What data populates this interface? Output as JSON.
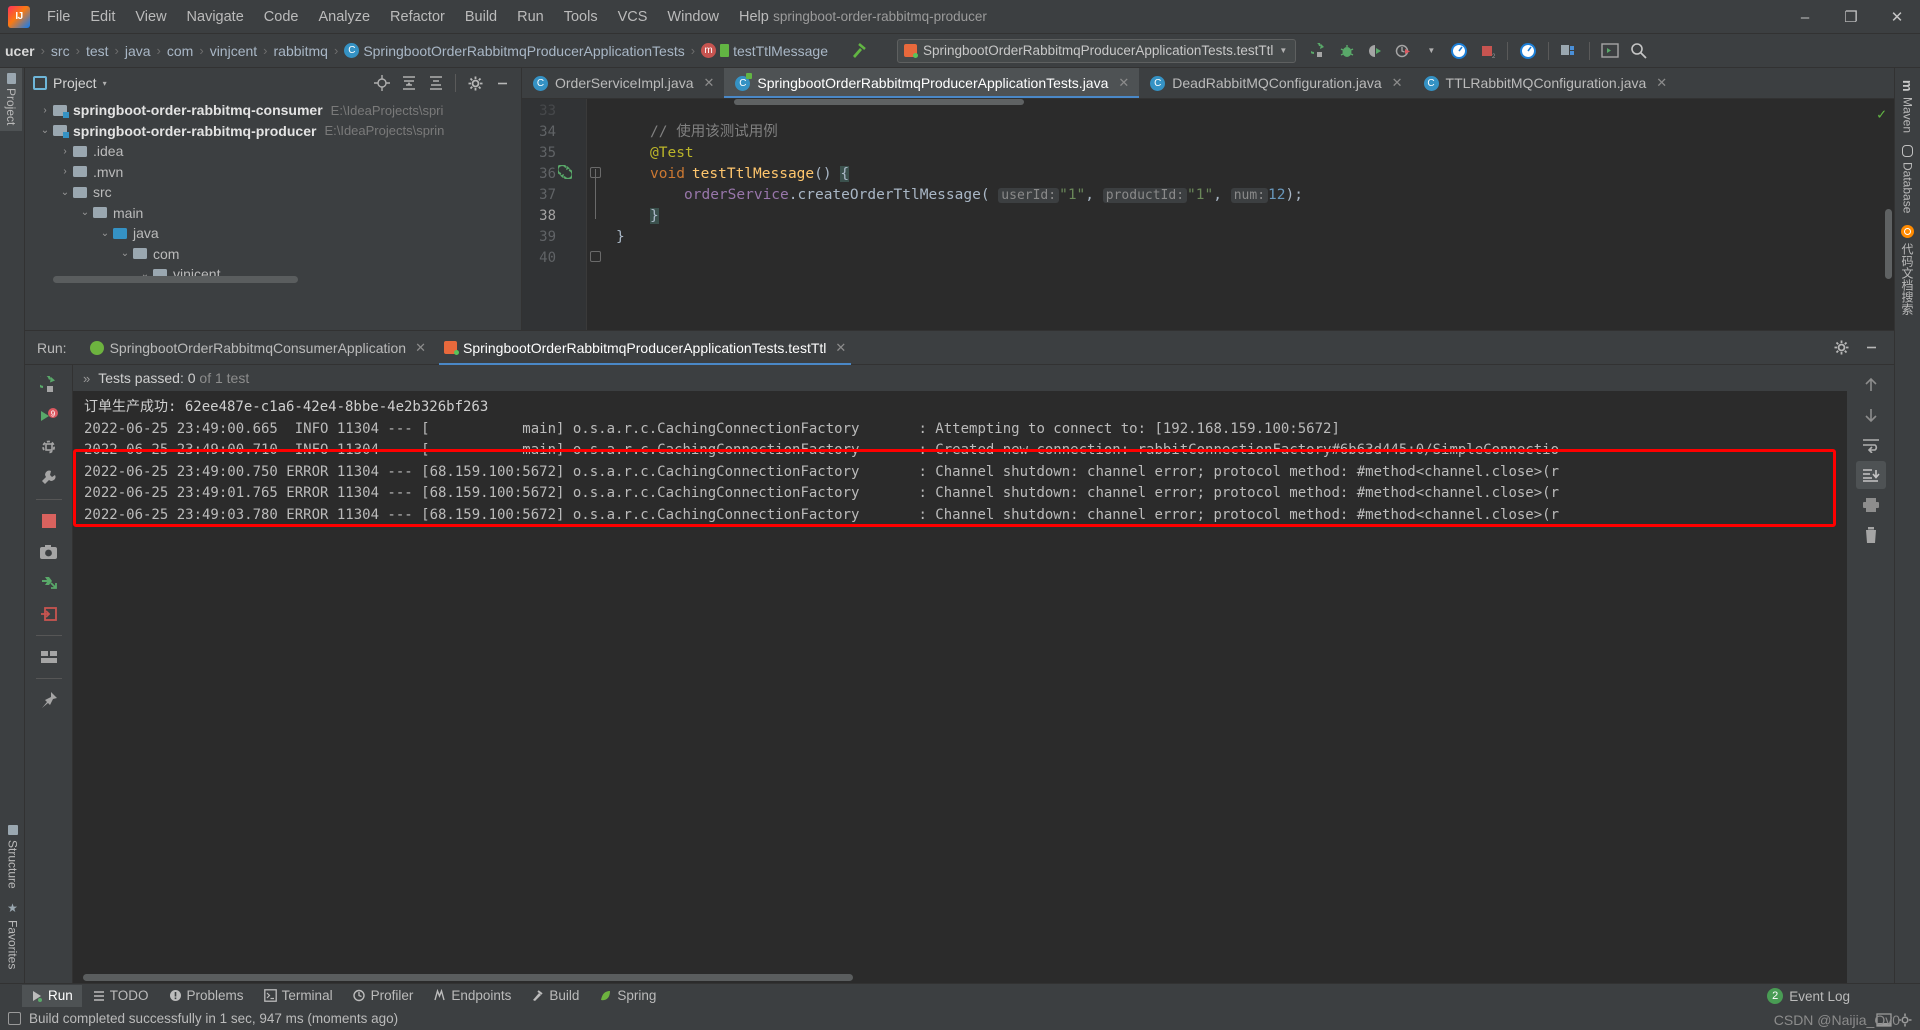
{
  "window": {
    "title": "springboot-order-rabbitmq-producer",
    "minimize_label": "–",
    "maximize_label": "❐",
    "close_label": "✕"
  },
  "menu": {
    "items": [
      "File",
      "Edit",
      "View",
      "Navigate",
      "Code",
      "Analyze",
      "Refactor",
      "Build",
      "Run",
      "Tools",
      "VCS",
      "Window",
      "Help"
    ]
  },
  "breadcrumb": {
    "items": [
      {
        "label": "ucer",
        "icon": "module-icon"
      },
      {
        "label": "src",
        "icon": "folder-icon"
      },
      {
        "label": "test",
        "icon": "folder-icon"
      },
      {
        "label": "java",
        "icon": "folder-icon"
      },
      {
        "label": "com",
        "icon": "folder-icon"
      },
      {
        "label": "vinjcent",
        "icon": "folder-icon"
      },
      {
        "label": "rabbitmq",
        "icon": "folder-icon"
      },
      {
        "label": "SpringbootOrderRabbitmqProducerApplicationTests",
        "icon": "class-icon"
      },
      {
        "label": "testTtlMessage",
        "icon": "method-icon"
      }
    ],
    "separator": "›"
  },
  "run_config": {
    "name": "SpringbootOrderRabbitmqProducerApplicationTests.testTtl",
    "dropdown_caret": "▼"
  },
  "nav_tools": {
    "buttons": [
      "run-icon",
      "debug-icon",
      "run-with-coverage-icon",
      "profile-icon",
      "profile-dropdown-caret",
      "update-app-icon",
      "stop-icon",
      "services-icon",
      "project-structure-icon",
      "terminal-icon",
      "search-everywhere-icon"
    ]
  },
  "left_strip": {
    "top_items": [
      {
        "label": "Project",
        "icon": "project-folder-icon",
        "active": true
      }
    ],
    "bottom_items": [
      {
        "label": "Structure",
        "icon": "structure-icon"
      },
      {
        "label": "Favorites",
        "icon": "star-icon"
      }
    ]
  },
  "right_strip": {
    "items": [
      {
        "label": "Maven",
        "icon": "maven-m-icon"
      },
      {
        "label": "Database",
        "icon": "database-icon"
      },
      {
        "label": "代码文档搜索",
        "icon": "orange-circle-icon"
      }
    ]
  },
  "project_panel": {
    "title": "Project",
    "title_caret": "▾",
    "header_buttons": [
      "locate-icon",
      "expand-all-icon",
      "collapse-all-icon",
      "settings-gear-icon",
      "hide-icon"
    ],
    "tree": [
      {
        "indent": 0,
        "twisty": "›",
        "icon": "module-folder-icon",
        "label": "springboot-order-rabbitmq-consumer",
        "bold": true,
        "path": "E:\\IdeaProjects\\spri"
      },
      {
        "indent": 0,
        "twisty": "⌄",
        "icon": "module-folder-icon",
        "label": "springboot-order-rabbitmq-producer",
        "bold": true,
        "path": "E:\\IdeaProjects\\sprin"
      },
      {
        "indent": 1,
        "twisty": "›",
        "icon": "folder-icon",
        "label": ".idea",
        "bold": false,
        "path": ""
      },
      {
        "indent": 1,
        "twisty": "›",
        "icon": "folder-icon",
        "label": ".mvn",
        "bold": false,
        "path": ""
      },
      {
        "indent": 1,
        "twisty": "⌄",
        "icon": "folder-icon",
        "label": "src",
        "bold": false,
        "path": ""
      },
      {
        "indent": 2,
        "twisty": "⌄",
        "icon": "folder-icon",
        "label": "main",
        "bold": false,
        "path": ""
      },
      {
        "indent": 3,
        "twisty": "⌄",
        "icon": "source-folder-icon",
        "label": "java",
        "bold": false,
        "path": ""
      },
      {
        "indent": 4,
        "twisty": "⌄",
        "icon": "package-folder-icon",
        "label": "com",
        "bold": false,
        "path": ""
      },
      {
        "indent": 5,
        "twisty": "⌄",
        "icon": "package-folder-icon",
        "label": "vinjcent",
        "bold": false,
        "path": ""
      }
    ]
  },
  "editor": {
    "tabs": [
      {
        "label": "OrderServiceImpl.java",
        "icon": "java-class-icon",
        "active": false,
        "close": "✕"
      },
      {
        "label": "SpringbootOrderRabbitmqProducerApplicationTests.java",
        "icon": "java-test-class-icon",
        "active": true,
        "close": "✕"
      },
      {
        "label": "DeadRabbitMQConfiguration.java",
        "icon": "java-class-icon",
        "active": false,
        "close": "✕"
      },
      {
        "label": "TTLRabbitMQConfiguration.java",
        "icon": "java-class-icon",
        "active": false,
        "close": "✕"
      }
    ],
    "gutter_lines": [
      "33",
      "34",
      "35",
      "36",
      "37",
      "38",
      "39",
      "40"
    ],
    "current_line": "38",
    "code": {
      "line_34_comment": "// 使用该测试用例",
      "line_35_annotation": "@Test",
      "line_36_kw": "void",
      "line_36_method": "testTtlMessage",
      "line_36_parens": "() ",
      "line_36_brace": "{",
      "line_37_field": "orderService",
      "line_37_dot": ".",
      "line_37_call": "createOrderTtlMessage",
      "line_37_open": "( ",
      "hint_userid": "userId:",
      "arg_userid": "\"1\"",
      "hint_productid": "productId:",
      "arg_productid": "\"1\"",
      "hint_num": "num:",
      "arg_num": "12",
      "line_37_close": ");",
      "line_38_brace": "}",
      "line_39_brace": "}"
    },
    "inspection_status": "✓"
  },
  "run_window": {
    "label": "Run:",
    "tabs": [
      {
        "label": "SpringbootOrderRabbitmqConsumerApplication",
        "icon": "spring-boot-icon",
        "active": false,
        "close": "✕"
      },
      {
        "label": "SpringbootOrderRabbitmqProducerApplicationTests.testTtl",
        "icon": "junit-test-icon",
        "active": true,
        "close": "✕"
      }
    ],
    "header_buttons": [
      "settings-gear-icon",
      "hide-window-icon"
    ],
    "tests_summary_prefix": "Tests passed: 0",
    "tests_summary_suffix": " of 1 test",
    "expand_chevron": "»",
    "side_buttons": [
      "rerun-icon",
      "rerun-failed-icon",
      "toggle-auto-test-icon",
      "test-settings-wrench-icon",
      "stop-icon",
      "export-screenshot-icon",
      "import-tests-icon",
      "export-test-results-icon",
      "layout-icon",
      "pin-tab-icon"
    ],
    "console_buttons": [
      "scroll-up-icon",
      "scroll-down-icon",
      "soft-wrap-icon",
      "scroll-to-end-icon",
      "print-icon",
      "clear-all-icon"
    ],
    "console_lines": [
      {
        "text": "订单生产成功: 62ee487e-c1a6-42e4-8bbe-4e2b326bf263",
        "level": "plain"
      },
      {
        "text": "2022-06-25 23:49:00.665  INFO 11304 --- [           main] o.s.a.r.c.CachingConnectionFactory       : Attempting to connect to: [192.168.159.100:5672]",
        "level": "info"
      },
      {
        "text": "2022-06-25 23:49:00.710  INFO 11304 --- [           main] o.s.a.r.c.CachingConnectionFactory       : Created new connection: rabbitConnectionFactory#6b63d445:0/SimpleConnectio",
        "level": "info"
      },
      {
        "text": "2022-06-25 23:49:00.750 ERROR 11304 --- [68.159.100:5672] o.s.a.r.c.CachingConnectionFactory       : Channel shutdown: channel error; protocol method: #method<channel.close>(r",
        "level": "error"
      },
      {
        "text": "2022-06-25 23:49:01.765 ERROR 11304 --- [68.159.100:5672] o.s.a.r.c.CachingConnectionFactory       : Channel shutdown: channel error; protocol method: #method<channel.close>(r",
        "level": "error"
      },
      {
        "text": "2022-06-25 23:49:03.780 ERROR 11304 --- [68.159.100:5672] o.s.a.r.c.CachingConnectionFactory       : Channel shutdown: channel error; protocol method: #method<channel.close>(r",
        "level": "error"
      }
    ],
    "highlight_color": "#ff0000"
  },
  "bottom_tool_buttons": [
    {
      "label": "Run",
      "icon": "run-triangle-icon",
      "active": true
    },
    {
      "label": "TODO",
      "icon": "todo-list-icon",
      "active": false
    },
    {
      "label": "Problems",
      "icon": "problems-icon",
      "active": false
    },
    {
      "label": "Terminal",
      "icon": "terminal-icon",
      "active": false
    },
    {
      "label": "Profiler",
      "icon": "profiler-icon",
      "active": false
    },
    {
      "label": "Endpoints",
      "icon": "endpoints-icon",
      "active": false
    },
    {
      "label": "Build",
      "icon": "build-hammer-icon",
      "active": false
    },
    {
      "label": "Spring",
      "icon": "spring-leaf-icon",
      "active": false
    }
  ],
  "status_bar": {
    "message": "Build completed successfully in 1 sec, 947 ms (moments ago)",
    "icon": "build-status-icon"
  },
  "event_log": {
    "label": "Event Log",
    "count": "2"
  },
  "watermark": "CSDN @Naijia_Ov0"
}
